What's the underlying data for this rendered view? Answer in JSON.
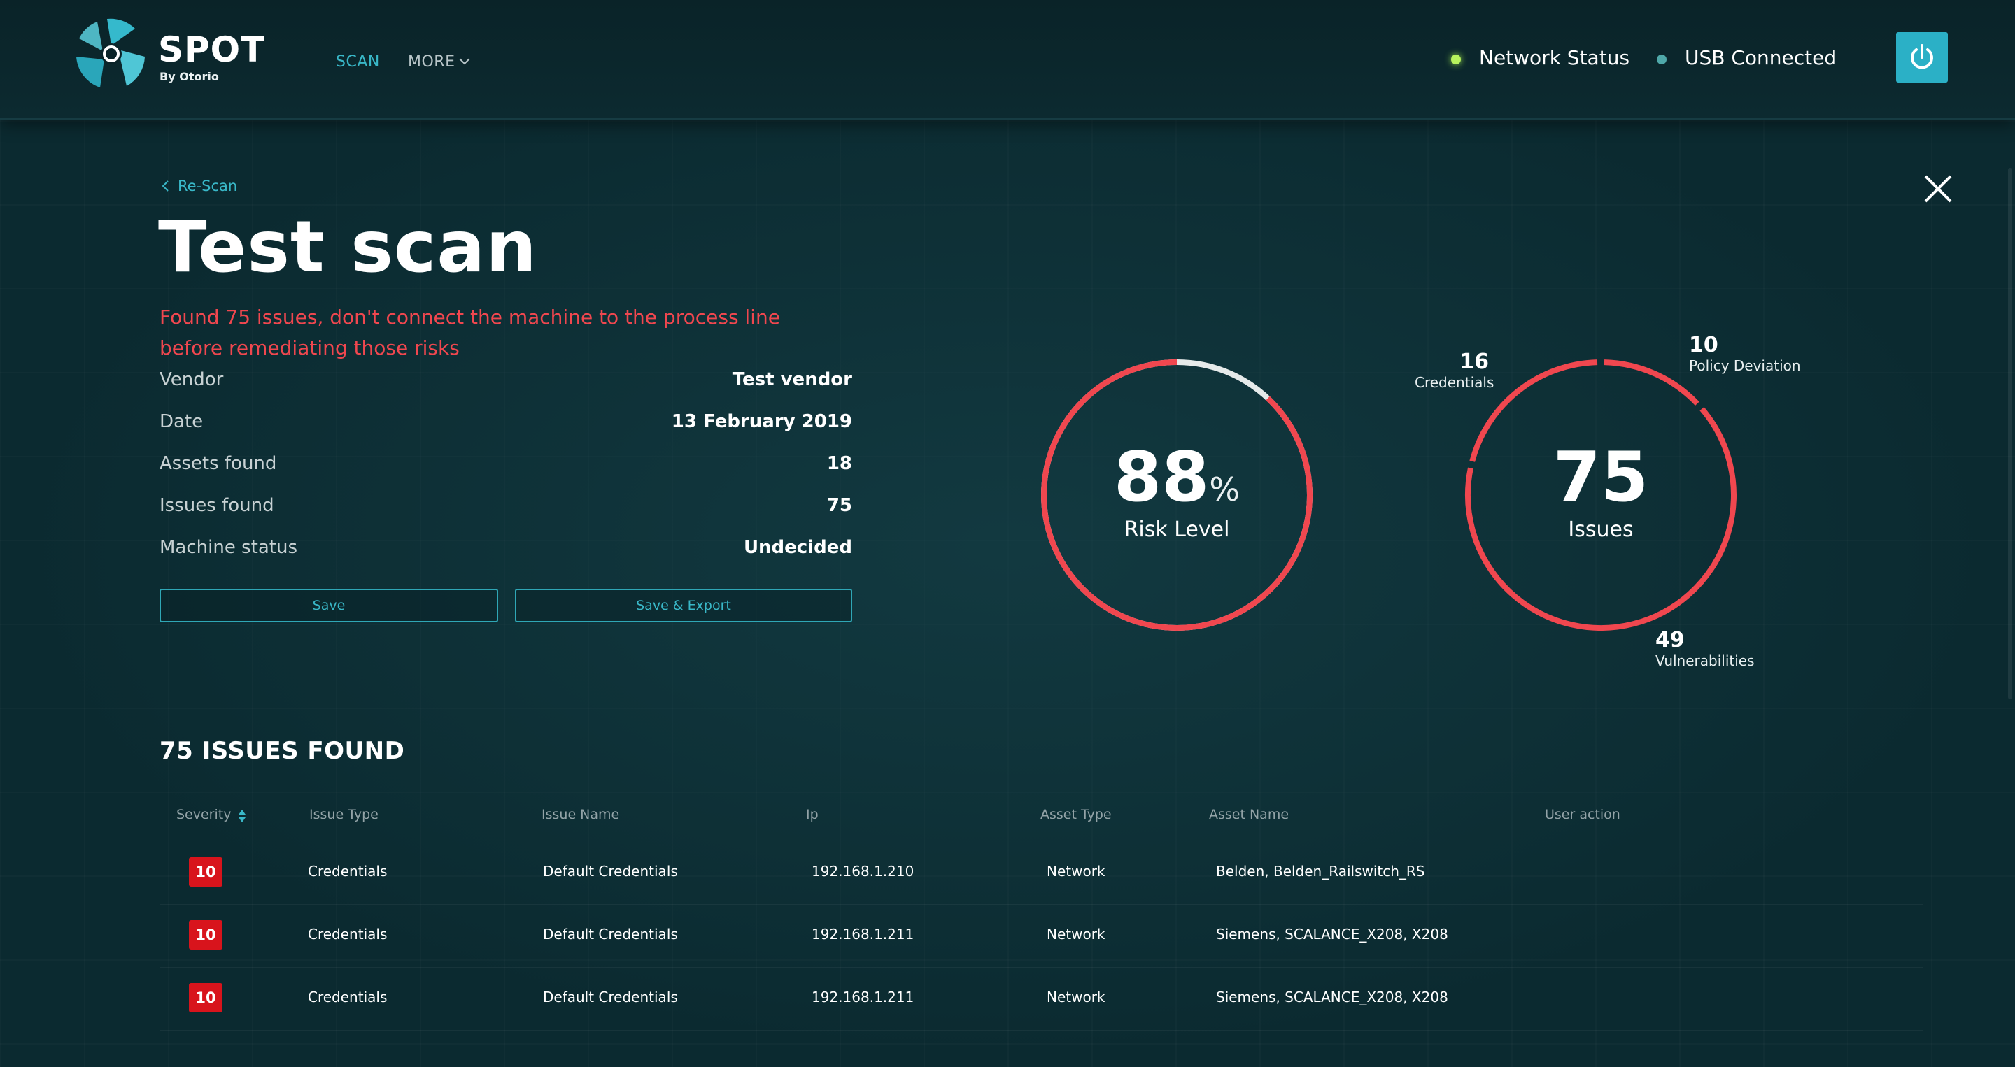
{
  "app": {
    "brand": "SPOT",
    "brand_sub": "By Otorio"
  },
  "nav": {
    "scan": "SCAN",
    "more": "MORE"
  },
  "status": {
    "network": "Network Status",
    "usb": "USB Connected",
    "network_color": "#b7f35d",
    "usb_color": "#4fa8a9"
  },
  "scan": {
    "back_label": "Re-Scan",
    "title": "Test scan",
    "warning": "Found 75 issues, don't connect the machine to the process line before remediating those risks",
    "fields": [
      {
        "key": "Vendor",
        "value": "Test vendor"
      },
      {
        "key": "Date",
        "value": "13 February 2019"
      },
      {
        "key": "Assets found",
        "value": "18"
      },
      {
        "key": "Issues found",
        "value": "75"
      },
      {
        "key": "Machine status",
        "value": "Undecided"
      }
    ],
    "save_label": "Save",
    "export_label": "Save & Export"
  },
  "risk": {
    "value": "88",
    "unit": "%",
    "label": "Risk Level",
    "fraction": 0.88
  },
  "issues_summary": {
    "total": "75",
    "label": "Issues",
    "credentials": {
      "count": "16",
      "label": "Credentials"
    },
    "policy": {
      "count": "10",
      "label": "Policy Deviation"
    },
    "vulnerabilities": {
      "count": "49",
      "label": "Vulnerabilities"
    }
  },
  "table": {
    "heading": "75 ISSUES FOUND",
    "columns": [
      "Severity",
      "Issue Type",
      "Issue Name",
      "Ip",
      "Asset Type",
      "Asset Name",
      "User action"
    ],
    "rows": [
      {
        "severity": "10",
        "type": "Credentials",
        "name": "Default Credentials",
        "ip": "192.168.1.210",
        "asset_type": "Network",
        "asset_name": "Belden, Belden_Railswitch_RS",
        "action": ""
      },
      {
        "severity": "10",
        "type": "Credentials",
        "name": "Default Credentials",
        "ip": "192.168.1.211",
        "asset_type": "Network",
        "asset_name": "Siemens, SCALANCE_X208, X208",
        "action": ""
      },
      {
        "severity": "10",
        "type": "Credentials",
        "name": "Default Credentials",
        "ip": "192.168.1.211",
        "asset_type": "Network",
        "asset_name": "Siemens, SCALANCE_X208, X208",
        "action": ""
      }
    ]
  },
  "colors": {
    "accent": "#39b8c8",
    "danger": "#f0474f",
    "severity_bg": "#d8141c"
  }
}
